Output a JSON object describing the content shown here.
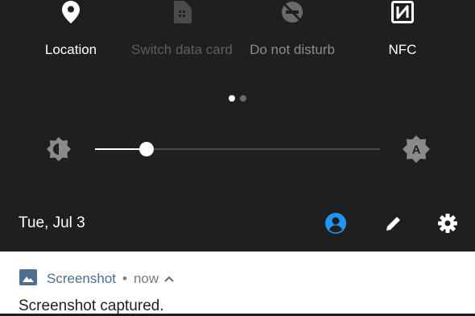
{
  "tiles": [
    {
      "label": "Location",
      "icon": "location-pin-icon",
      "state": "on"
    },
    {
      "label": "Switch data card",
      "icon": "sim-card-icon",
      "state": "dim"
    },
    {
      "label": "Do not disturb",
      "icon": "do-not-disturb-icon",
      "state": "mid"
    },
    {
      "label": "NFC",
      "icon": "nfc-icon",
      "state": "on"
    }
  ],
  "pager": {
    "pages": 2,
    "current": 1
  },
  "brightness": {
    "level": 0.18,
    "auto_icon": "brightness-auto-icon",
    "low_icon": "brightness-low-icon"
  },
  "header": {
    "date": "Tue, Jul 3",
    "icons": [
      "user-account-icon",
      "edit-icon",
      "settings-icon"
    ]
  },
  "notification": {
    "app_icon": "image-icon",
    "app_name": "Screenshot",
    "separator": "•",
    "time": "now",
    "expand_icon": "chevron-up-icon",
    "text": "Screenshot captured."
  },
  "colors": {
    "panel_bg": "#1f1f1f",
    "accent_blue": "#2196f3",
    "app_name_blue": "#4f6f8f",
    "notification_bg": "#ffffff"
  }
}
